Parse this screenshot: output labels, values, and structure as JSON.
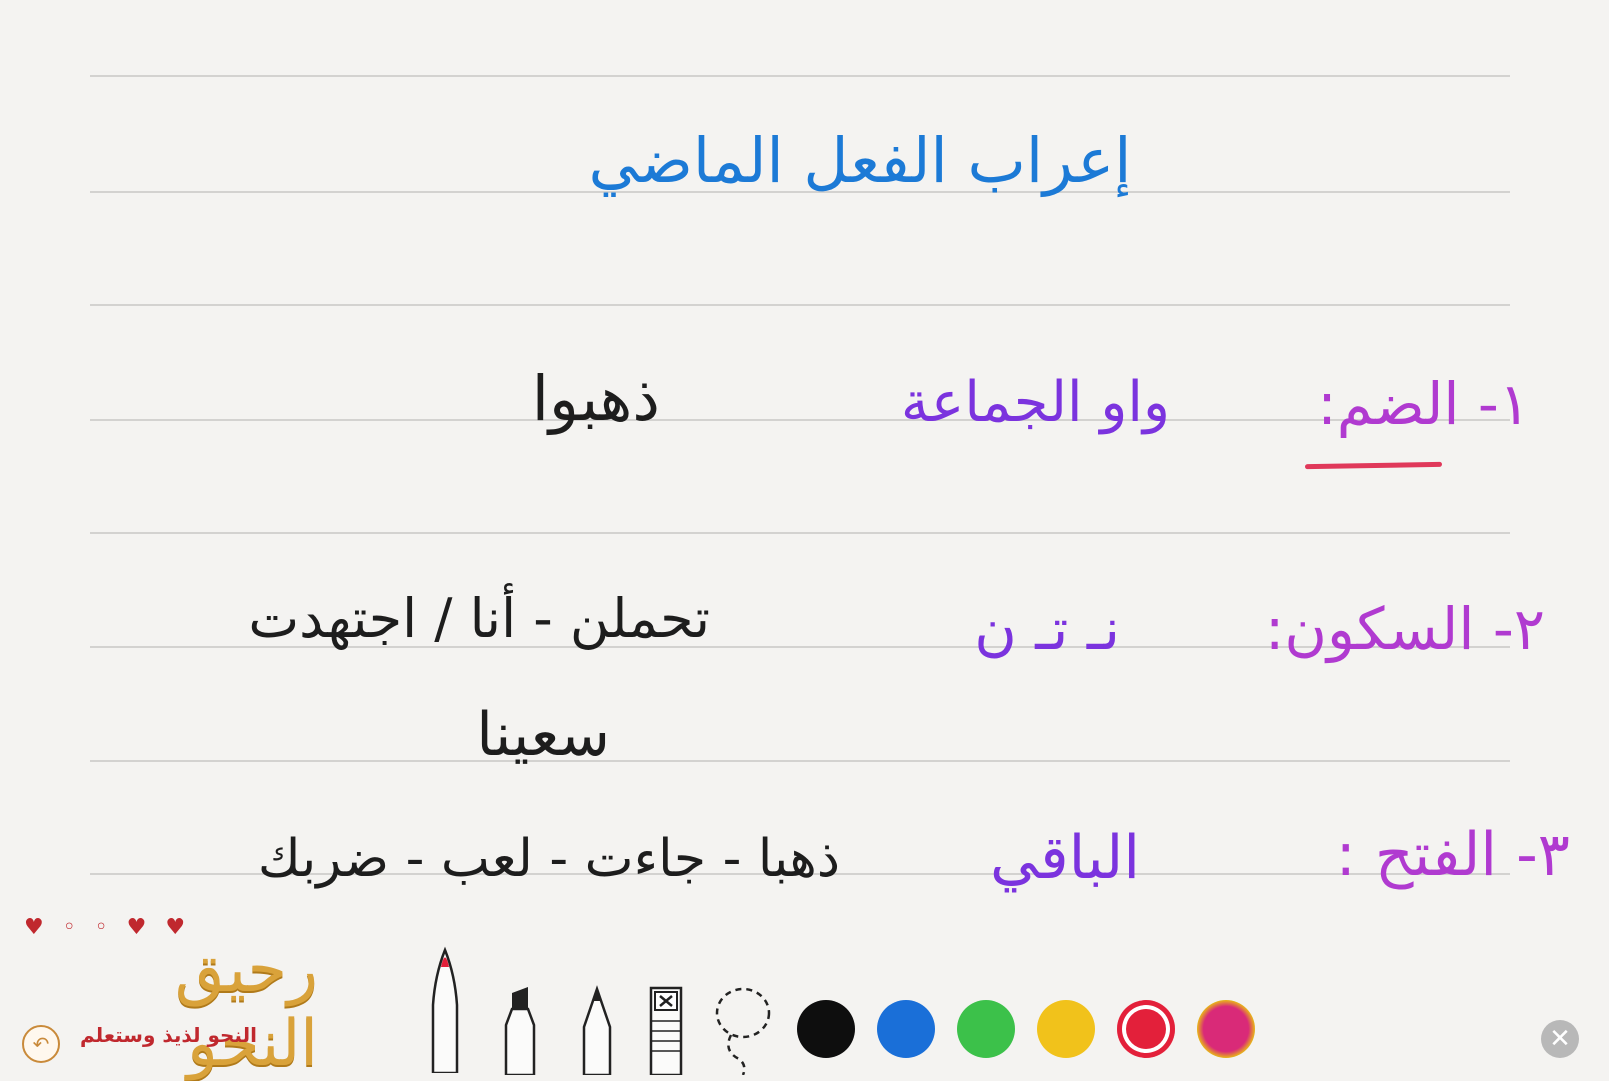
{
  "note": {
    "title": "إعراب الفعل الماضي",
    "rows": [
      {
        "label": "١- الضم:",
        "ending": "واو الجماعة",
        "examples": [
          "ذهبوا"
        ]
      },
      {
        "label": "٢- السكون:",
        "ending": "نـ تـ ن",
        "examples": [
          "تحملن - أنا / اجتهدت",
          "سعينا"
        ]
      },
      {
        "label": "٣- الفتح :",
        "ending": "الباقي",
        "examples": [
          "ذهبا - جاءت - لعب - ضربك"
        ]
      }
    ]
  },
  "colors": {
    "paper": "#f4f3f1",
    "rule": "#d3d2d0",
    "title": "#1c7ad6",
    "ink_black": "#1d1d1d",
    "ink_purple": "#7b33de",
    "ink_magenta": "#b03ad0",
    "underline_red": "#e0385a"
  },
  "logo": {
    "name": "رحيق النحو",
    "tagline": "النحو لذيذ وستعلم"
  },
  "toolbar": {
    "tools": [
      "pen-icon",
      "marker-icon",
      "pencil-icon",
      "eraser-icon",
      "lasso-icon"
    ],
    "swatches": [
      "#0e0e0e",
      "#1a6fd8",
      "#3cc14a",
      "#f1c21b",
      "#e3203a",
      "#d92a78"
    ],
    "selected_swatch": "#e3203a"
  }
}
